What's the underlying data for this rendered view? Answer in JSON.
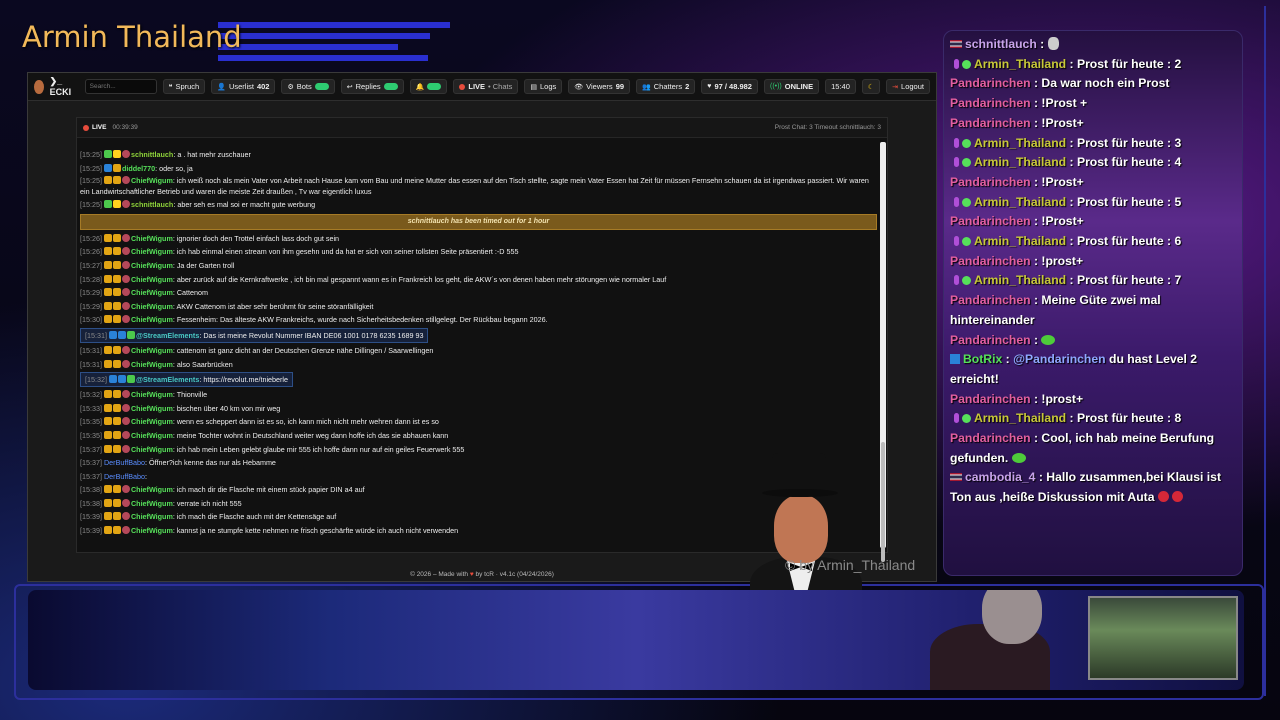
{
  "stream": {
    "title": "Armin Thailand",
    "watermark": "© by Armin_Thailand"
  },
  "app": {
    "brand": "❯_ ECKI",
    "search_placeholder": "Search...",
    "toolbar": [
      {
        "label": "Spruch"
      },
      {
        "label": "Userlist",
        "count": "402"
      },
      {
        "label": "Bots"
      },
      {
        "label": "Replies"
      },
      {
        "label": "LIVE",
        "suffix": "• Chats"
      },
      {
        "label": "Logs"
      },
      {
        "label": "Viewers",
        "count": "99"
      },
      {
        "label": "Chatters",
        "count": "2"
      },
      {
        "label": "97 / 48.982"
      },
      {
        "label": "ONLINE"
      },
      {
        "label": "15:40"
      },
      {
        "label": "Logout"
      }
    ],
    "chat_header": {
      "live": "LIVE",
      "uptime": "00:39:39",
      "right": "Prost Chat: 3   Timeout schnittlauch: 3"
    },
    "timeout_notice": "schnittlauch has been timed out for 1 hour",
    "messages_a": [
      {
        "ts": "[15:25]",
        "user": "schnittlauch",
        "cls": "u-lime",
        "text": ": a . hat mehr zuschauer"
      },
      {
        "ts": "[15:25]",
        "user": "diddel770",
        "cls": "u-green",
        "text": ": oder so, ja"
      }
    ],
    "messages_a_wrap": {
      "ts": "[15:25]",
      "user": "ChiefWigum",
      "text": ": ich weiß noch als mein Vater von Arbeit nach Hause kam vom Bau und meine Mutter das essen auf den Tisch stellte, sagte mein Vater Essen hat Zeit für müssen Fernsehn schauen da ist irgendwas passiert. Wir waren ein Landwirtschaftlicher Betrieb und waren die meiste Zeit draußen , Tv war eigentlich luxus"
    },
    "messages_a2": {
      "ts": "[15:25]",
      "user": "schnittlauch",
      "text": ": aber seh es mal soi er macht gute werbung"
    },
    "messages_b": [
      {
        "ts": "[15:26]",
        "user": "ChiefWigum",
        "text": ": ignorier doch den Trottel einfach lass doch gut sein"
      },
      {
        "ts": "[15:26]",
        "user": "ChiefWigum",
        "text": ": ich hab einmal einen stream von ihm gesehn und da hat er sich von seiner tollsten Seite präsentiert :-D 555"
      },
      {
        "ts": "[15:27]",
        "user": "ChiefWigum",
        "text": ": Ja der Garten troll"
      },
      {
        "ts": "[15:28]",
        "user": "ChiefWigum",
        "text": ": aber zurück auf die Kernkraftwerke , ich bin mal gespannt wann es in Frankreich los geht, die AKW´s von denen haben mehr störungen wie normaler Lauf"
      },
      {
        "ts": "[15:29]",
        "user": "ChiefWigum",
        "text": ": Cattenom"
      },
      {
        "ts": "[15:29]",
        "user": "ChiefWigum",
        "text": ": AKW Cattenom ist aber sehr berühmt für seine störanfälligkeit"
      },
      {
        "ts": "[15:30]",
        "user": "ChiefWigum",
        "text": ": Fessenheim: Das älteste AKW Frankreichs, wurde nach Sicherheitsbedenken stillgelegt. Der Rückbau begann 2026."
      }
    ],
    "bot1": {
      "ts": "[15:31]",
      "user": "@StreamElements",
      "text": ": Das ist meine Revolut Nummer IBAN DE06 1001 0178 6235 1689 93"
    },
    "messages_c": [
      {
        "ts": "[15:31]",
        "user": "ChiefWigum",
        "text": ": cattenom ist ganz dicht an der Deutschen Grenze nähe Dillingen / Saarwellingen"
      },
      {
        "ts": "[15:31]",
        "user": "ChiefWigum",
        "text": ": also Saarbrücken"
      }
    ],
    "bot2": {
      "ts": "[15:32]",
      "user": "@StreamElements",
      "text": ": https://revolut.me/tnieberle"
    },
    "messages_d": [
      {
        "ts": "[15:32]",
        "user": "ChiefWigum",
        "text": ": Thionville",
        "type": "chief"
      },
      {
        "ts": "[15:33]",
        "user": "ChiefWigum",
        "text": ": bischen über 40 km von mir weg",
        "type": "chief"
      },
      {
        "ts": "[15:35]",
        "user": "ChiefWigum",
        "text": ": wenn es scheppert dann ist es so, ich kann mich nicht mehr wehren dann ist es so",
        "type": "chief"
      },
      {
        "ts": "[15:35]",
        "user": "ChiefWigum",
        "text": ": meine Tochter wohnt in Deutschland weiter weg dann hoffe ich das sie abhauen kann",
        "type": "chief"
      },
      {
        "ts": "[15:37]",
        "user": "ChiefWigum",
        "text": ": ich hab mein Leben gelebt glaube mir 555 ich hoffe dann nur auf ein geiles Feuerwerk 555",
        "type": "chief"
      },
      {
        "ts": "[15:37]",
        "user": "DerBuffBabo",
        "text": ": Öffner?ich kenne das nur als Hebamme",
        "type": "buff"
      },
      {
        "ts": "[15:37]",
        "user": "DerBuffBabo",
        "text": ":",
        "type": "buff"
      },
      {
        "ts": "[15:38]",
        "user": "ChiefWigum",
        "text": ": ich mach dir die Flasche mit einem stück papier DIN a4 auf",
        "type": "chief"
      },
      {
        "ts": "[15:38]",
        "user": "ChiefWigum",
        "text": ": verrate ich nicht 555",
        "type": "chief"
      },
      {
        "ts": "[15:39]",
        "user": "ChiefWigum",
        "text": ": ich mach die Flasche auch mit der Kettensäge auf",
        "type": "chief"
      },
      {
        "ts": "[15:39]",
        "user": "ChiefWigum",
        "text": ": kannst ja ne stumpfe kette nehmen ne frisch geschärfte würde ich auch nicht verwenden",
        "type": "chief"
      }
    ],
    "footer": {
      "pre": "© 2026 – Made with",
      "post": "by tcR · v4.1c (04/24/2026)"
    }
  },
  "overlay": [
    {
      "user": "schnittlauch",
      "text": " : ",
      "flag": true,
      "cls": "u-lav",
      "emote": "bunny"
    },
    {
      "user": "Armin_Thailand",
      "text": " : Prost für heute : 2",
      "badges": true,
      "cls": "u-olive"
    },
    {
      "user": "Pandarinchen",
      "text": " : Da war noch ein Prost",
      "cls": "u-pink"
    },
    {
      "user": "Pandarinchen",
      "text": " : !Prost +",
      "cls": "u-pink"
    },
    {
      "user": "Pandarinchen",
      "text": " : !Prost+",
      "cls": "u-pink"
    },
    {
      "user": "Armin_Thailand",
      "text": " : Prost für heute : 3",
      "badges": true,
      "cls": "u-olive"
    },
    {
      "user": "Armin_Thailand",
      "text": " : Prost für heute : 4",
      "badges": true,
      "cls": "u-olive"
    },
    {
      "user": "Pandarinchen",
      "text": " : !Prost+",
      "cls": "u-pink"
    },
    {
      "user": "Armin_Thailand",
      "text": " : Prost für heute : 5",
      "badges": true,
      "cls": "u-olive"
    },
    {
      "user": "Pandarinchen",
      "text": " : !Prost+",
      "cls": "u-pink"
    },
    {
      "user": "Armin_Thailand",
      "text": " : Prost für heute : 6",
      "badges": true,
      "cls": "u-olive"
    },
    {
      "user": "Pandarinchen",
      "text": " : !prost+",
      "cls": "u-pink"
    },
    {
      "user": "Armin_Thailand",
      "text": " : Prost für heute : 7",
      "badges": true,
      "cls": "u-olive"
    },
    {
      "user": "Pandarinchen",
      "text": " : Meine Güte zwei mal hintereinander",
      "cls": "u-pink"
    },
    {
      "user": "Pandarinchen",
      "text": " : ",
      "cls": "u-pink",
      "emote": "frog"
    },
    {
      "user": "BotRix",
      "text": " du hast Level 2 erreicht!",
      "cls": "u-botrix",
      "mention": "@Pandarinchen",
      "share": true
    },
    {
      "user": "Pandarinchen",
      "text": " : !prost+",
      "cls": "u-pink"
    },
    {
      "user": "Armin_Thailand",
      "text": " : Prost für heute : 8",
      "badges": true,
      "cls": "u-olive"
    },
    {
      "user": "Pandarinchen",
      "text": " : Cool, ich hab meine Berufung gefunden. ",
      "cls": "u-pink",
      "emote": "frog"
    },
    {
      "user": "cambodia_4",
      "text": " : Hallo zusammen,bei Klausi ist Ton aus ,heiße Diskussion mit Auta ",
      "flag": true,
      "cls": "u-lav",
      "emote": "box2"
    }
  ]
}
